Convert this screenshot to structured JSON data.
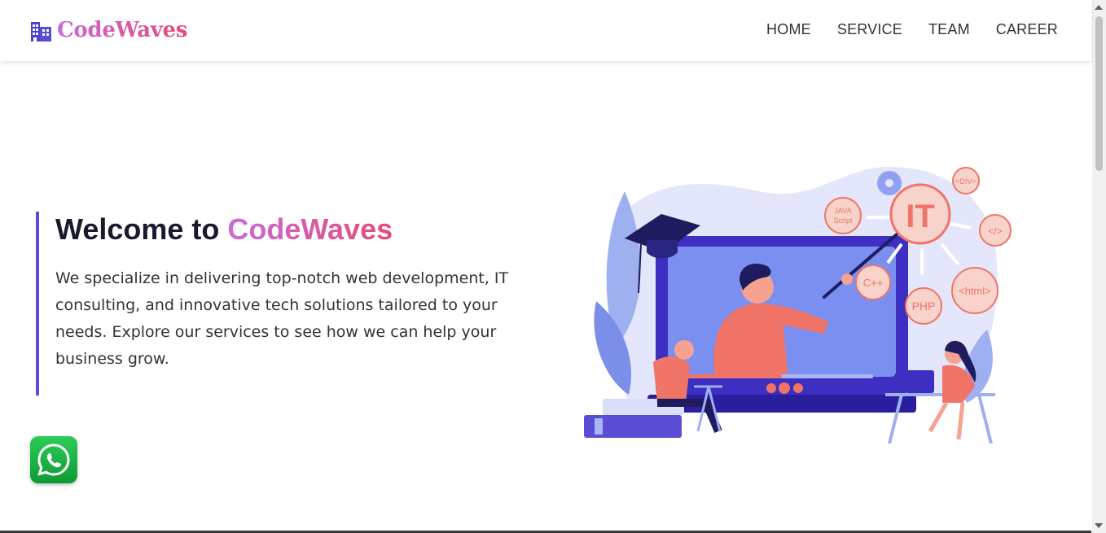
{
  "brand": {
    "name": "CodeWaves",
    "icon": "building-icon"
  },
  "nav": {
    "items": [
      "HOME",
      "SERVICE",
      "TEAM",
      "CAREER"
    ]
  },
  "hero": {
    "title_prefix": "Welcome to ",
    "title_accent": "CodeWaves",
    "description": "We specialize in delivering top-notch web development, IT consulting, and innovative tech solutions tailored to your needs. Explore our services to see how we can help your business grow."
  },
  "illustration": {
    "badges": {
      "it": "IT",
      "javascript_1": "JAVA",
      "javascript_2": "Script",
      "div": "<DIV>",
      "code": "</>",
      "cpp": "C++",
      "php": "PHP",
      "html": "<html>"
    }
  },
  "whatsapp": {
    "icon": "whatsapp-icon"
  },
  "colors": {
    "accent": "#5b4cd6",
    "brand_from": "#c86dd7",
    "brand_to": "#e64a7a",
    "whatsapp": "#1fb14a"
  }
}
